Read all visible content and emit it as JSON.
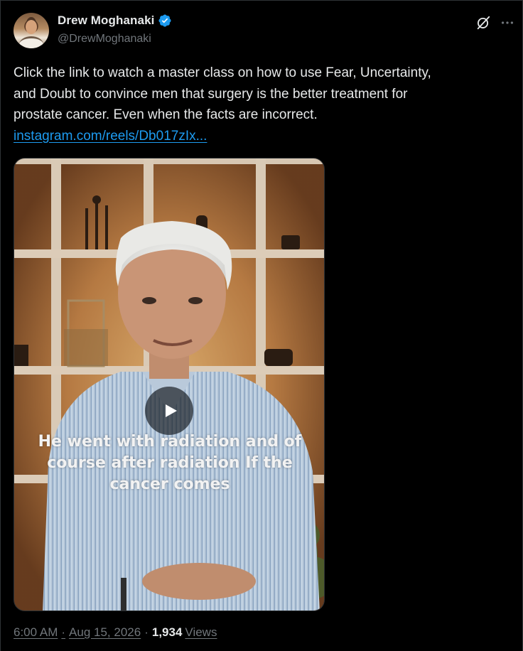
{
  "author": {
    "display_name": "Drew Moghanaki",
    "handle": "@DrewMoghanaki",
    "verified": true
  },
  "header_icons": [
    "grok-icon",
    "more-icon"
  ],
  "tweet": {
    "lines": [
      "Click the link to watch a master class on how to use Fear, Uncertainty,",
      "and Doubt to convince men that surgery is the better treatment for",
      "prostate cancer. Even when the facts are incorrect."
    ],
    "link_text": "instagram.com/reels/Db017zIx..."
  },
  "media": {
    "type": "video",
    "caption_lines": [
      "He went with radiation and of",
      "course after radiation If the",
      "cancer comes"
    ]
  },
  "meta": {
    "time": "6:00 AM",
    "date": "Aug 15, 2026",
    "separator": "·",
    "views_count": "1,934",
    "views_label": "Views"
  },
  "colors": {
    "background": "#000000",
    "text": "#e7e9ea",
    "secondary": "#71767b",
    "link": "#1d9bf0",
    "verified": "#1d9bf0"
  }
}
